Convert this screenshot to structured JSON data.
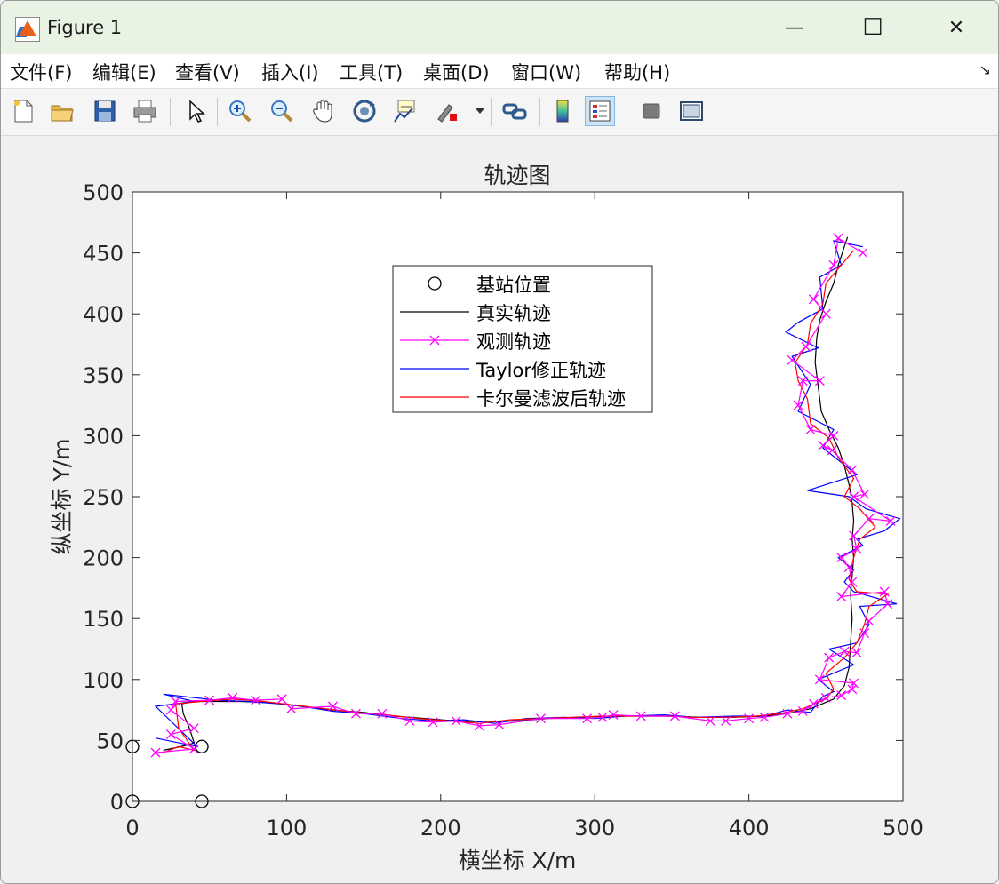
{
  "window": {
    "title": "Figure 1",
    "minimize_glyph": "—",
    "maximize_glyph": "☐",
    "close_glyph": "✕"
  },
  "menu": [
    "文件(F)",
    "编辑(E)",
    "查看(V)",
    "插入(I)",
    "工具(T)",
    "桌面(D)",
    "窗口(W)",
    "帮助(H)"
  ],
  "menu_overflow_glyph": "↘",
  "toolbar": {
    "icons": [
      "new-file-icon",
      "open-folder-icon",
      "save-icon",
      "print-icon",
      "pointer-icon",
      "zoom-in-icon",
      "zoom-out-icon",
      "pan-hand-icon",
      "rotate-3d-icon",
      "data-cursor-icon",
      "brush-icon",
      "link-plot-icon",
      "colorbar-icon",
      "legend-icon",
      "hide-plot-tools-icon",
      "show-plot-tools-icon"
    ],
    "active": "legend-icon"
  },
  "chart_data": {
    "type": "line",
    "title": "轨迹图",
    "xlabel": "横坐标 X/m",
    "ylabel": "纵坐标 Y/m",
    "xlim": [
      0,
      500
    ],
    "ylim": [
      0,
      500
    ],
    "xticks": [
      0,
      100,
      200,
      300,
      400,
      500
    ],
    "yticks": [
      0,
      50,
      100,
      150,
      200,
      250,
      300,
      350,
      400,
      450,
      500
    ],
    "grid": false,
    "legend_position": "top-center",
    "legend": [
      "基站位置",
      "真实轨迹",
      "观测轨迹",
      "Taylor修正轨迹",
      "卡尔曼滤波后轨迹"
    ],
    "series": [
      {
        "name": "基站位置",
        "color": "#000000",
        "marker": "o",
        "line": "none",
        "points": [
          [
            0,
            0
          ],
          [
            45,
            0
          ],
          [
            45,
            45
          ],
          [
            0,
            45
          ]
        ]
      },
      {
        "name": "真实轨迹",
        "color": "#000000",
        "marker": "none",
        "points": [
          [
            20,
            42
          ],
          [
            28,
            44
          ],
          [
            35,
            46
          ],
          [
            40,
            48
          ],
          [
            37,
            60
          ],
          [
            33,
            72
          ],
          [
            32,
            80
          ],
          [
            40,
            82
          ],
          [
            55,
            82
          ],
          [
            70,
            82
          ],
          [
            90,
            81
          ],
          [
            110,
            78
          ],
          [
            130,
            75
          ],
          [
            150,
            73
          ],
          [
            170,
            70
          ],
          [
            190,
            68
          ],
          [
            210,
            66
          ],
          [
            230,
            65
          ],
          [
            250,
            66
          ],
          [
            270,
            68
          ],
          [
            290,
            69
          ],
          [
            310,
            70
          ],
          [
            330,
            70
          ],
          [
            350,
            70
          ],
          [
            370,
            69
          ],
          [
            390,
            69
          ],
          [
            410,
            70
          ],
          [
            425,
            72
          ],
          [
            440,
            76
          ],
          [
            455,
            84
          ],
          [
            462,
            95
          ],
          [
            465,
            110
          ],
          [
            466,
            130
          ],
          [
            467,
            150
          ],
          [
            466,
            170
          ],
          [
            467,
            185
          ],
          [
            468,
            200
          ],
          [
            467,
            215
          ],
          [
            468,
            230
          ],
          [
            467,
            245
          ],
          [
            465,
            260
          ],
          [
            462,
            275
          ],
          [
            458,
            290
          ],
          [
            452,
            305
          ],
          [
            447,
            320
          ],
          [
            445,
            340
          ],
          [
            443,
            360
          ],
          [
            444,
            380
          ],
          [
            446,
            395
          ],
          [
            450,
            410
          ],
          [
            455,
            425
          ],
          [
            458,
            440
          ],
          [
            464,
            463
          ]
        ]
      },
      {
        "name": "观测轨迹",
        "color": "#ff00ff",
        "marker": "x",
        "points": [
          [
            15,
            40
          ],
          [
            40,
            43
          ],
          [
            25,
            55
          ],
          [
            40,
            60
          ],
          [
            25,
            75
          ],
          [
            28,
            82
          ],
          [
            50,
            83
          ],
          [
            65,
            85
          ],
          [
            80,
            83
          ],
          [
            97,
            84
          ],
          [
            103,
            76
          ],
          [
            130,
            78
          ],
          [
            145,
            72
          ],
          [
            162,
            72
          ],
          [
            180,
            66
          ],
          [
            195,
            65
          ],
          [
            210,
            66
          ],
          [
            225,
            62
          ],
          [
            238,
            63
          ],
          [
            265,
            68
          ],
          [
            295,
            68
          ],
          [
            305,
            69
          ],
          [
            312,
            71
          ],
          [
            330,
            70
          ],
          [
            352,
            70
          ],
          [
            375,
            66
          ],
          [
            385,
            66
          ],
          [
            400,
            68
          ],
          [
            410,
            69
          ],
          [
            425,
            72
          ],
          [
            435,
            74
          ],
          [
            442,
            80
          ],
          [
            450,
            85
          ],
          [
            460,
            87
          ],
          [
            467,
            92
          ],
          [
            468,
            97
          ],
          [
            446,
            100
          ],
          [
            452,
            118
          ],
          [
            462,
            123
          ],
          [
            470,
            122
          ],
          [
            475,
            138
          ],
          [
            478,
            148
          ],
          [
            490,
            162
          ],
          [
            488,
            172
          ],
          [
            460,
            168
          ],
          [
            467,
            180
          ],
          [
            465,
            192
          ],
          [
            460,
            200
          ],
          [
            470,
            207
          ],
          [
            468,
            218
          ],
          [
            478,
            232
          ],
          [
            492,
            230
          ],
          [
            468,
            250
          ],
          [
            475,
            252
          ],
          [
            467,
            272
          ],
          [
            454,
            288
          ],
          [
            448,
            292
          ],
          [
            455,
            300
          ],
          [
            440,
            305
          ],
          [
            432,
            325
          ],
          [
            435,
            345
          ],
          [
            446,
            345
          ],
          [
            428,
            362
          ],
          [
            437,
            373
          ],
          [
            450,
            400
          ],
          [
            442,
            412
          ],
          [
            455,
            440
          ],
          [
            458,
            462
          ],
          [
            474,
            450
          ]
        ]
      },
      {
        "name": "Taylor修正轨迹",
        "color": "#0000ff",
        "marker": "none",
        "points": [
          [
            15,
            52
          ],
          [
            42,
            45
          ],
          [
            15,
            78
          ],
          [
            40,
            82
          ],
          [
            20,
            88
          ],
          [
            55,
            83
          ],
          [
            75,
            82
          ],
          [
            95,
            80
          ],
          [
            110,
            78
          ],
          [
            130,
            74
          ],
          [
            150,
            72
          ],
          [
            175,
            68
          ],
          [
            195,
            66
          ],
          [
            215,
            67
          ],
          [
            235,
            64
          ],
          [
            255,
            68
          ],
          [
            280,
            69
          ],
          [
            300,
            68
          ],
          [
            320,
            70
          ],
          [
            345,
            71
          ],
          [
            365,
            69
          ],
          [
            390,
            70
          ],
          [
            410,
            70
          ],
          [
            425,
            75
          ],
          [
            440,
            73
          ],
          [
            448,
            86
          ],
          [
            455,
            90
          ],
          [
            445,
            100
          ],
          [
            468,
            112
          ],
          [
            452,
            125
          ],
          [
            470,
            130
          ],
          [
            478,
            145
          ],
          [
            472,
            160
          ],
          [
            496,
            162
          ],
          [
            468,
            172
          ],
          [
            462,
            180
          ],
          [
            468,
            190
          ],
          [
            458,
            200
          ],
          [
            474,
            210
          ],
          [
            470,
            215
          ],
          [
            488,
            222
          ],
          [
            498,
            232
          ],
          [
            476,
            240
          ],
          [
            465,
            250
          ],
          [
            438,
            255
          ],
          [
            470,
            268
          ],
          [
            448,
            290
          ],
          [
            455,
            305
          ],
          [
            432,
            320
          ],
          [
            440,
            342
          ],
          [
            428,
            365
          ],
          [
            445,
            372
          ],
          [
            424,
            385
          ],
          [
            432,
            393
          ],
          [
            448,
            404
          ],
          [
            446,
            430
          ],
          [
            460,
            440
          ],
          [
            455,
            460
          ],
          [
            474,
            455
          ]
        ]
      },
      {
        "name": "卡尔曼滤波后轨迹",
        "color": "#ff0000",
        "marker": "none",
        "points": [
          [
            20,
            40
          ],
          [
            30,
            45
          ],
          [
            40,
            42
          ],
          [
            30,
            60
          ],
          [
            28,
            80
          ],
          [
            45,
            82
          ],
          [
            65,
            84
          ],
          [
            85,
            82
          ],
          [
            105,
            79
          ],
          [
            125,
            76
          ],
          [
            145,
            73
          ],
          [
            165,
            71
          ],
          [
            185,
            68
          ],
          [
            205,
            66
          ],
          [
            225,
            64
          ],
          [
            245,
            67
          ],
          [
            265,
            68
          ],
          [
            285,
            69
          ],
          [
            305,
            70
          ],
          [
            325,
            70
          ],
          [
            345,
            70
          ],
          [
            365,
            69
          ],
          [
            385,
            69
          ],
          [
            405,
            70
          ],
          [
            420,
            72
          ],
          [
            435,
            76
          ],
          [
            450,
            84
          ],
          [
            455,
            92
          ],
          [
            450,
            105
          ],
          [
            462,
            118
          ],
          [
            470,
            130
          ],
          [
            475,
            145
          ],
          [
            478,
            160
          ],
          [
            490,
            170
          ],
          [
            470,
            172
          ],
          [
            465,
            182
          ],
          [
            468,
            200
          ],
          [
            472,
            215
          ],
          [
            482,
            225
          ],
          [
            472,
            240
          ],
          [
            462,
            250
          ],
          [
            468,
            265
          ],
          [
            458,
            282
          ],
          [
            452,
            298
          ],
          [
            440,
            310
          ],
          [
            438,
            330
          ],
          [
            432,
            345
          ],
          [
            430,
            360
          ],
          [
            438,
            375
          ],
          [
            440,
            392
          ],
          [
            448,
            408
          ],
          [
            450,
            425
          ],
          [
            460,
            440
          ],
          [
            468,
            452
          ]
        ]
      }
    ]
  }
}
